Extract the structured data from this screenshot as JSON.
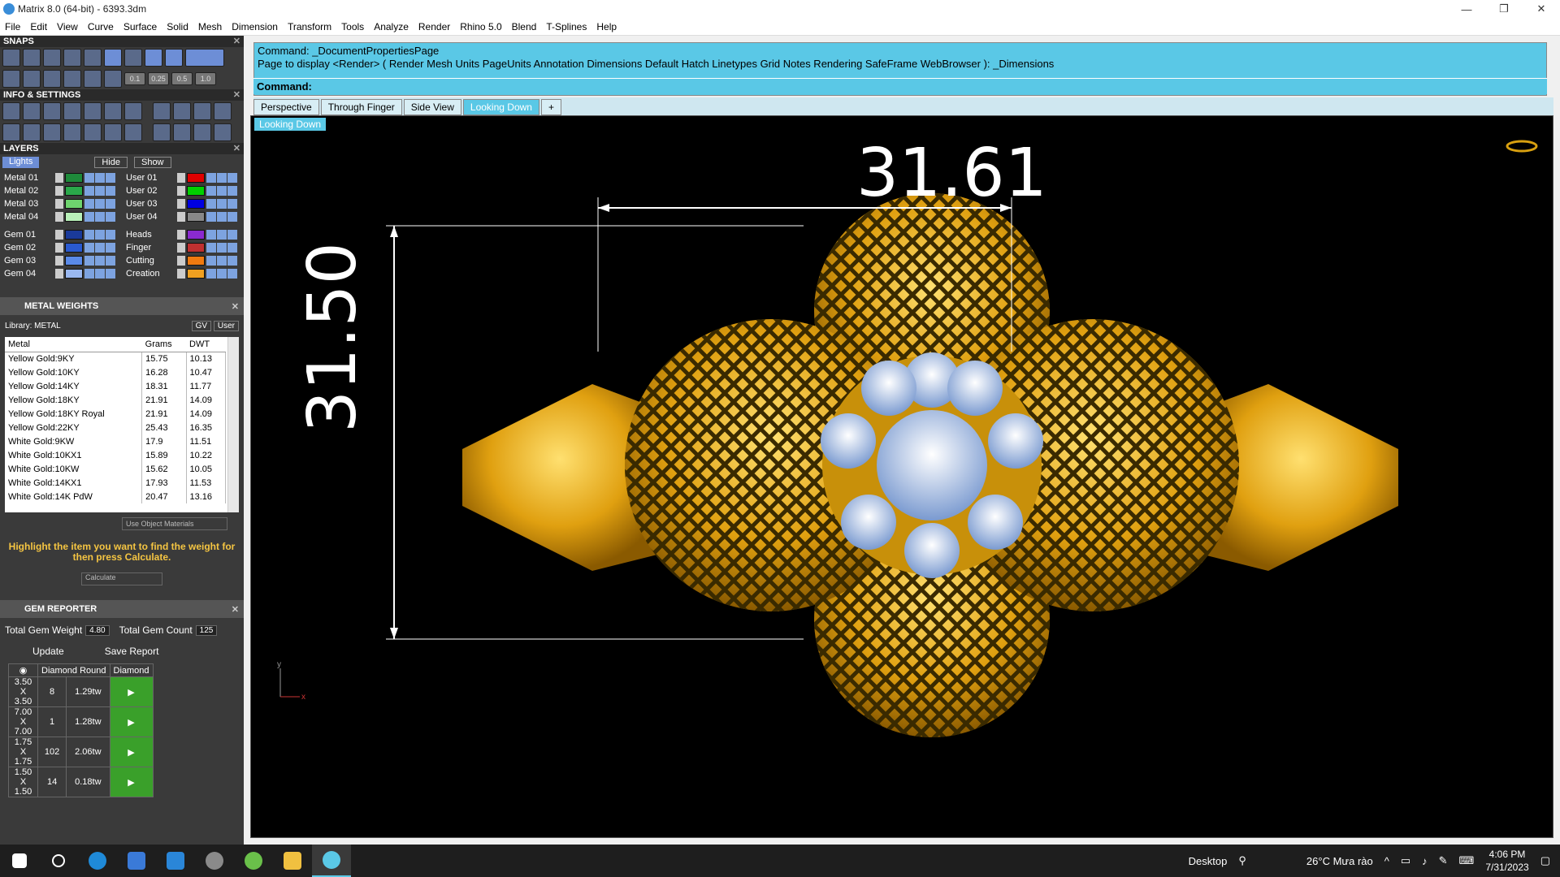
{
  "window": {
    "title": "Matrix 8.0 (64-bit) - 6393.3dm",
    "min": "—",
    "max": "❐",
    "close": "✕"
  },
  "menu": [
    "File",
    "Edit",
    "View",
    "Curve",
    "Surface",
    "Solid",
    "Mesh",
    "Dimension",
    "Transform",
    "Tools",
    "Analyze",
    "Render",
    "Rhino 5.0",
    "Blend",
    "T-Splines",
    "Help"
  ],
  "panels": {
    "snaps": "SNAPS",
    "info": "INFO & SETTINGS",
    "layers": "LAYERS",
    "snapvals": [
      "0.1",
      "0.25",
      "0.5",
      "1.0"
    ],
    "hide": "Hide",
    "show": "Show",
    "lights": "Lights"
  },
  "layers": {
    "left": [
      {
        "name": "Metal 01",
        "color": "#1e8a3a"
      },
      {
        "name": "Metal 02",
        "color": "#2aa84a"
      },
      {
        "name": "Metal 03",
        "color": "#6ed46e"
      },
      {
        "name": "Metal 04",
        "color": "#b8f0b8"
      },
      {
        "name": "Gem 01",
        "color": "#1a3a9a"
      },
      {
        "name": "Gem 02",
        "color": "#2a5ad0"
      },
      {
        "name": "Gem 03",
        "color": "#5a8ae8"
      },
      {
        "name": "Gem 04",
        "color": "#9ab8f0"
      }
    ],
    "right": [
      {
        "name": "User 01",
        "color": "#e00000"
      },
      {
        "name": "User 02",
        "color": "#00d000"
      },
      {
        "name": "User 03",
        "color": "#0000e0"
      },
      {
        "name": "User 04",
        "color": "#888888"
      },
      {
        "name": "Heads",
        "color": "#8a2ad0"
      },
      {
        "name": "Finger",
        "color": "#c03030"
      },
      {
        "name": "Cutting",
        "color": "#f07a10"
      },
      {
        "name": "Creation",
        "color": "#f0a020"
      }
    ]
  },
  "metal_weights": {
    "title": "METAL WEIGHTS",
    "library": "Library: METAL",
    "gv": "GV",
    "user": "User",
    "headers": [
      "Metal",
      "Grams",
      "DWT"
    ],
    "rows": [
      [
        "Yellow Gold:9KY",
        "15.75",
        "10.13"
      ],
      [
        "Yellow Gold:10KY",
        "16.28",
        "10.47"
      ],
      [
        "Yellow Gold:14KY",
        "18.31",
        "11.77"
      ],
      [
        "Yellow Gold:18KY",
        "21.91",
        "14.09"
      ],
      [
        "Yellow Gold:18KY Royal",
        "21.91",
        "14.09"
      ],
      [
        "Yellow Gold:22KY",
        "25.43",
        "16.35"
      ],
      [
        "White Gold:9KW",
        "17.9",
        "11.51"
      ],
      [
        "White Gold:10KX1",
        "15.89",
        "10.22"
      ],
      [
        "White Gold:10KW",
        "15.62",
        "10.05"
      ],
      [
        "White Gold:14KX1",
        "17.93",
        "11.53"
      ],
      [
        "White Gold:14K PdW",
        "20.47",
        "13.16"
      ]
    ],
    "use_object": "Use Object Materials",
    "hint": "Highlight the item you want to find the weight for then press Calculate.",
    "calculate": "Calculate"
  },
  "gem_reporter": {
    "title": "GEM REPORTER",
    "total_weight_label": "Total Gem Weight",
    "total_weight": "4.80",
    "total_count_label": "Total Gem Count",
    "total_count": "125",
    "update": "Update",
    "save": "Save Report",
    "headers": [
      "Diamond Round",
      "Diamond"
    ],
    "rows": [
      [
        "3.50 X 3.50",
        "8",
        "1.29tw"
      ],
      [
        "7.00 X 7.00",
        "1",
        "1.28tw"
      ],
      [
        "1.75 X 1.75",
        "102",
        "2.06tw"
      ],
      [
        "1.50 X 1.50",
        "14",
        "0.18tw"
      ]
    ]
  },
  "command": {
    "line1": "Command: _DocumentPropertiesPage",
    "line2": "Page to display <Render> ( Render  Mesh  Units  PageUnits  Annotation  Dimensions  Default  Hatch  Linetypes  Grid  Notes  Rendering  SafeFrame  WebBrowser ): _Dimensions",
    "prompt": "Command:"
  },
  "tabs": [
    "Perspective",
    "Through Finger",
    "Side View",
    "Looking Down",
    "+"
  ],
  "viewport": {
    "label": "Looking Down",
    "dim_width": "31.61",
    "dim_height": "31.50",
    "axis_y": "y",
    "axis_x": "x"
  },
  "taskbar": {
    "desktop": "Desktop",
    "weather": "26°C  Mưa rào",
    "time": "4:06 PM",
    "date": "7/31/2023"
  }
}
